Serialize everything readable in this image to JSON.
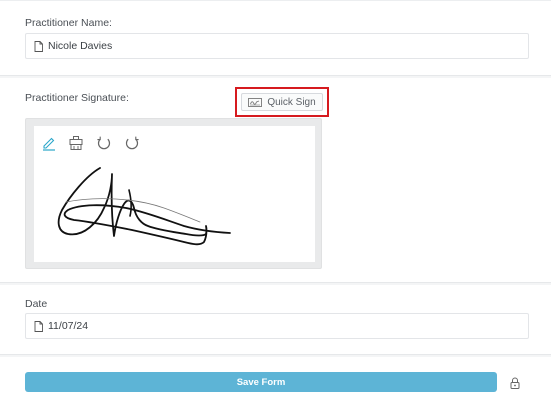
{
  "name_section": {
    "label": "Practitioner Name:",
    "value": "Nicole Davies"
  },
  "signature_section": {
    "label": "Practitioner Signature:",
    "quick_sign_label": "Quick Sign",
    "highlight_color": "#d61a1f",
    "tools": [
      "pen-icon",
      "eraser-icon",
      "undo-icon",
      "redo-icon"
    ],
    "active_tool_color": "#2aa6c9"
  },
  "date_section": {
    "label": "Date",
    "value": "11/07/24"
  },
  "footer": {
    "save_label": "Save Form",
    "save_color": "#5db4d6"
  }
}
